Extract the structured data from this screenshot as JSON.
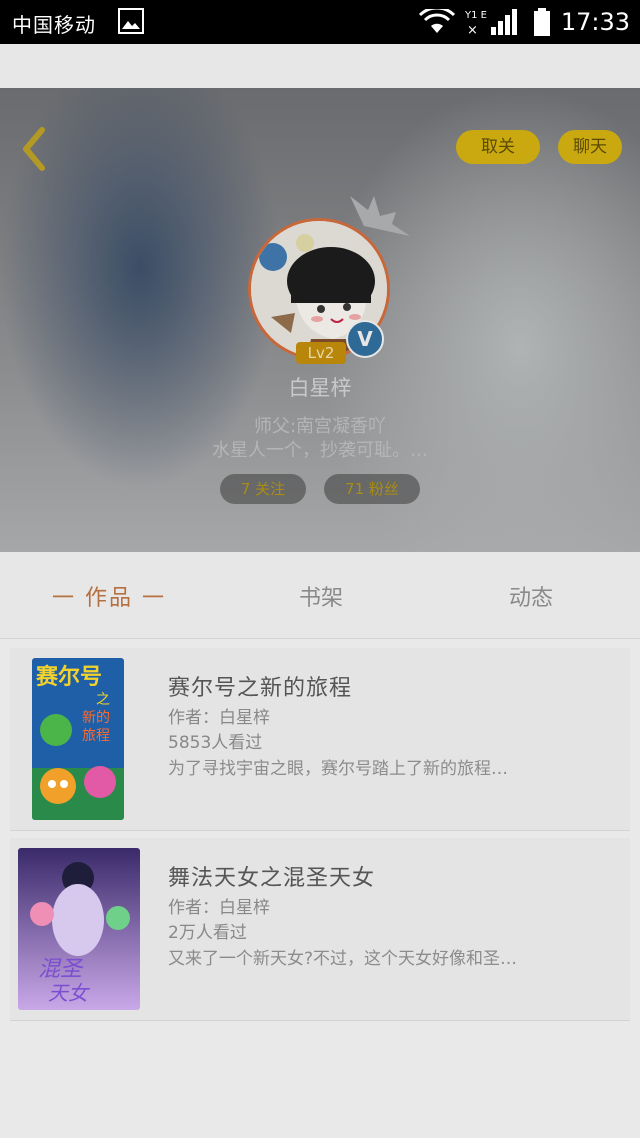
{
  "status_bar": {
    "carrier": "中国移动",
    "time": "17:33"
  },
  "header": {
    "unfollow_label": "取关",
    "chat_label": "聊天",
    "level": "Lv2",
    "verified_badge": "V",
    "username": "白星梓",
    "master_line": "师父:南宫凝香吖",
    "bio": "水星人一个，抄袭可耻。…",
    "following": "7 关注",
    "fans": "71 粉丝"
  },
  "tabs": {
    "works": "一 作品 一",
    "shelf": "书架",
    "activity": "动态"
  },
  "books": [
    {
      "title": "赛尔号之新的旅程",
      "author": "作者：白星梓",
      "reads": "5853人看过",
      "desc": "为了寻找宇宙之眼，赛尔号踏上了新的旅程…",
      "cover_text": "赛尔号之新的旅程"
    },
    {
      "title": "舞法天女之混圣天女",
      "author": "作者：白星梓",
      "reads": "2万人看过",
      "desc": "又来了一个新天女?不过，这个天女好像和圣…",
      "cover_text": "混圣天女"
    }
  ],
  "colors": {
    "accent_tab": "#b5703f",
    "button_yellow": "#c9a90f",
    "verified_blue": "#2f6a96"
  },
  "icons": [
    "back-arrow-icon",
    "wifi-icon",
    "signal-icon",
    "battery-icon",
    "gallery-icon",
    "crown-icon"
  ]
}
